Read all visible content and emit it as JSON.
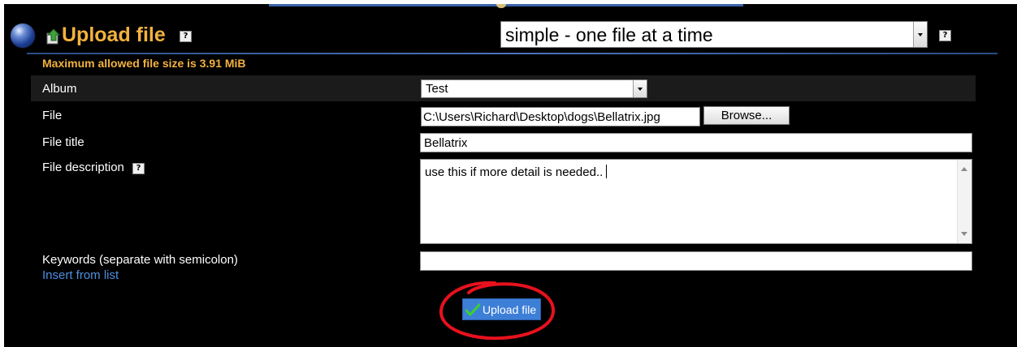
{
  "header": {
    "title": "Upload file",
    "mode_select": {
      "selected": "simple - one file at a time"
    },
    "help_glyph": "?"
  },
  "max_size_text": "Maximum allowed file size is 3.91 MiB",
  "form": {
    "album": {
      "label": "Album",
      "selected": "Test"
    },
    "file": {
      "label": "File",
      "value": "C:\\Users\\Richard\\Desktop\\dogs\\Bellatrix.jpg",
      "browse_label": "Browse..."
    },
    "file_title": {
      "label": "File title",
      "value": "Bellatrix"
    },
    "file_description": {
      "label": "File description",
      "value": "use this if more detail is needed.."
    },
    "keywords": {
      "label": "Keywords (separate with semicolon)",
      "value": "",
      "insert_link": "Insert from list"
    }
  },
  "submit": {
    "label": "Upload file"
  },
  "colors": {
    "title": "#f2b23f",
    "link": "#4f8fe0",
    "button": "#3d7fd7",
    "annotation": "#e8111e"
  },
  "icons": {
    "orb": "blue-orb-icon",
    "upload": "upload-arrow-icon",
    "help": "help-icon",
    "check": "checkmark-icon"
  }
}
